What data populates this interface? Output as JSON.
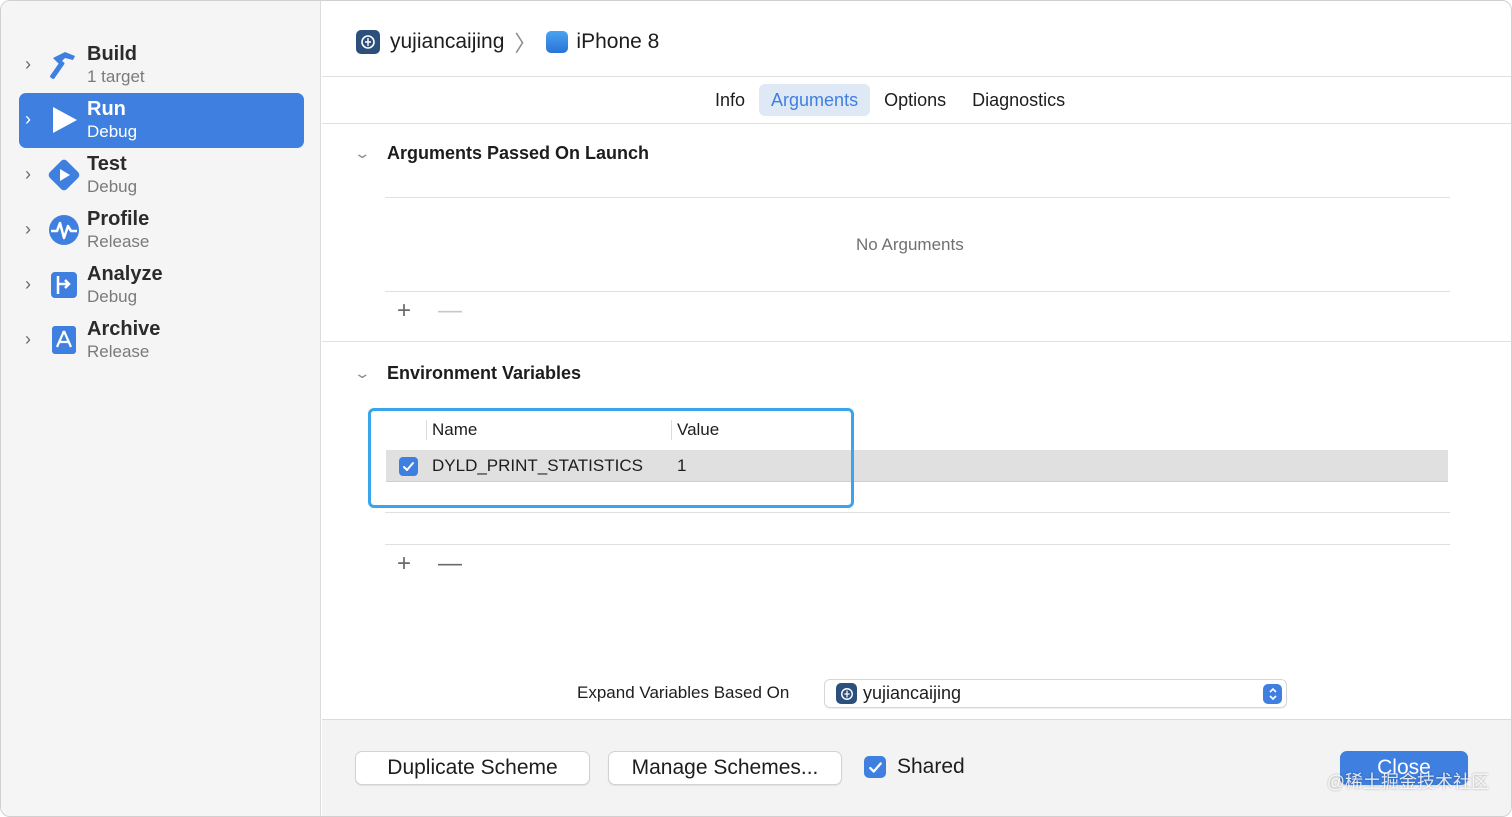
{
  "sidebar": {
    "items": [
      {
        "title": "Build",
        "subtitle": "1 target",
        "icon": "hammer-icon",
        "selected": false
      },
      {
        "title": "Run",
        "subtitle": "Debug",
        "icon": "play-icon",
        "selected": true
      },
      {
        "title": "Test",
        "subtitle": "Debug",
        "icon": "test-diamond-icon",
        "selected": false
      },
      {
        "title": "Profile",
        "subtitle": "Release",
        "icon": "waveform-icon",
        "selected": false
      },
      {
        "title": "Analyze",
        "subtitle": "Debug",
        "icon": "analyze-icon",
        "selected": false
      },
      {
        "title": "Archive",
        "subtitle": "Release",
        "icon": "archive-icon",
        "selected": false
      }
    ]
  },
  "header": {
    "project": "yujiancaijing",
    "device": "iPhone 8"
  },
  "tabs": [
    {
      "label": "Info",
      "active": false
    },
    {
      "label": "Arguments",
      "active": true
    },
    {
      "label": "Options",
      "active": false
    },
    {
      "label": "Diagnostics",
      "active": false
    }
  ],
  "arguments": {
    "title": "Arguments Passed On Launch",
    "empty_text": "No Arguments"
  },
  "environment": {
    "title": "Environment Variables",
    "columns": {
      "name": "Name",
      "value": "Value"
    },
    "rows": [
      {
        "enabled": true,
        "name": "DYLD_PRINT_STATISTICS",
        "value": "1"
      }
    ]
  },
  "expand": {
    "label": "Expand Variables Based On",
    "selected": "yujiancaijing"
  },
  "footer": {
    "duplicate": "Duplicate Scheme",
    "manage": "Manage Schemes...",
    "shared_label": "Shared",
    "shared_checked": true,
    "close": "Close"
  },
  "watermark": "@稀土掘金技术社区",
  "colors": {
    "accent": "#3f7fe0",
    "highlight": "#3aa4ec"
  }
}
